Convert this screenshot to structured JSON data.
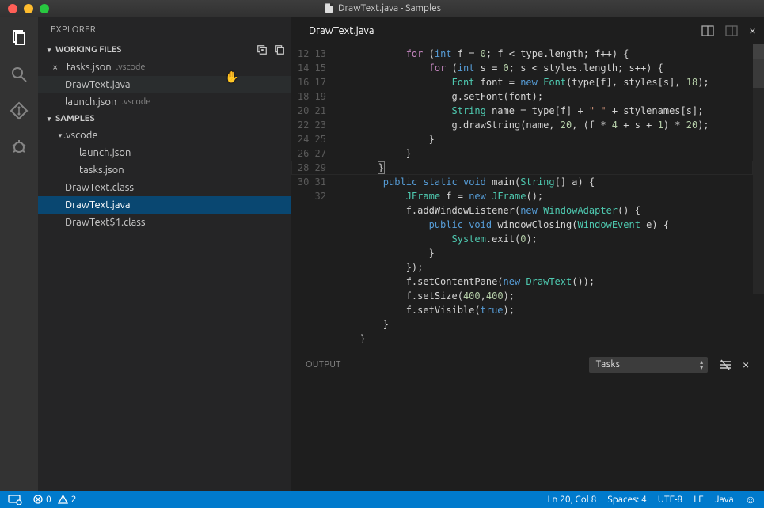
{
  "window": {
    "title": "DrawText.java - Samples"
  },
  "sidebar": {
    "title": "EXPLORER",
    "workingFiles": {
      "label": "WORKING FILES",
      "items": [
        {
          "name": "tasks.json",
          "folder": ".vscode",
          "dirty": true
        },
        {
          "name": "DrawText.java",
          "folder": "",
          "dirty": false
        },
        {
          "name": "launch.json",
          "folder": ".vscode",
          "dirty": false
        }
      ]
    },
    "project": {
      "label": "SAMPLES",
      "folder": ".vscode",
      "folderItems": [
        "launch.json",
        "tasks.json"
      ],
      "files": [
        "DrawText.class",
        "DrawText.java",
        "DrawText$1.class"
      ],
      "selected": "DrawText.java"
    }
  },
  "editor": {
    "tab": "DrawText.java",
    "firstLine": 12,
    "cursorLine": 20
  },
  "output": {
    "label": "OUTPUT",
    "selected": "Tasks"
  },
  "status": {
    "errors": "0",
    "warnings": "2",
    "position": "Ln 20, Col 8",
    "spaces": "Spaces: 4",
    "encoding": "UTF-8",
    "eol": "LF",
    "lang": "Java"
  }
}
